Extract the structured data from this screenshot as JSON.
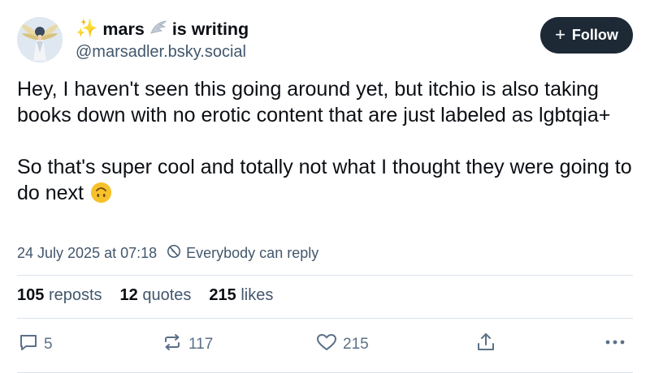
{
  "author": {
    "display_name_prefix_emoji": "✨",
    "display_name_part1": "mars",
    "display_name_mid_emoji": "🪽",
    "display_name_part2": "is writing",
    "handle": "@marsadler.bsky.social",
    "avatar_icon": "avatar-image"
  },
  "follow_button": {
    "label": "Follow",
    "icon": "plus-icon"
  },
  "post": {
    "line_1": "Hey, I haven't seen this going around yet, but itchio is also taking books down with no erotic content that are just labeled as lgbtqia+",
    "line_2": "So that's super cool and totally not what I thought they were going to do next",
    "emoji": "upside-down-face"
  },
  "meta": {
    "timestamp": "24 July 2025 at 07:18",
    "reply_permission": "Everybody can reply"
  },
  "stats": {
    "reposts_count": "105",
    "reposts_label": "reposts",
    "quotes_count": "12",
    "quotes_label": "quotes",
    "likes_count": "215",
    "likes_label": "likes"
  },
  "actions": {
    "reply_count": "5",
    "repost_count": "117",
    "like_count": "215"
  },
  "colors": {
    "text": "#0b0f14",
    "muted": "#42576c",
    "icon": "#5b7087",
    "follow_bg": "#1e2936",
    "divider": "#dbe2ea"
  }
}
